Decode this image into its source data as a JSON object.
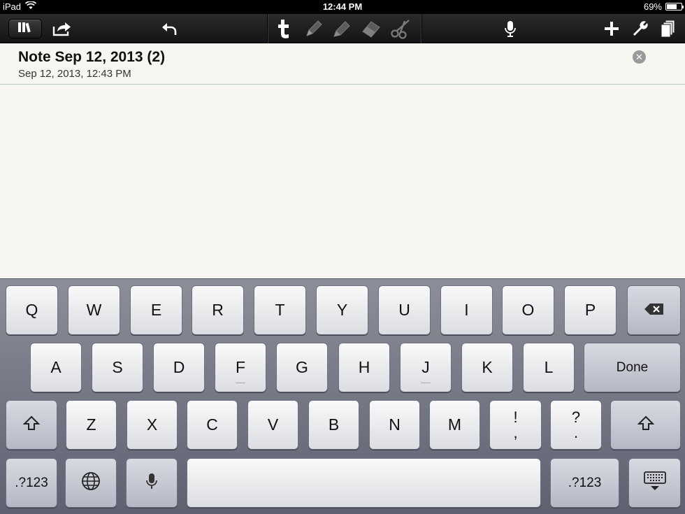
{
  "status_bar": {
    "device": "iPad",
    "time": "12:44 PM",
    "battery": "69%",
    "battery_level": 0.69
  },
  "toolbar": {
    "left_icons": [
      "library-icon",
      "share-icon",
      "undo-icon"
    ],
    "tool_icons": [
      "text-tool-icon",
      "pen-tool-icon",
      "highlighter-tool-icon",
      "eraser-tool-icon",
      "scissors-tool-icon"
    ],
    "right_icons": [
      "microphone-icon",
      "add-icon",
      "wrench-icon",
      "pages-icon"
    ]
  },
  "note": {
    "title": "Note Sep 12, 2013 (2)",
    "date": "Sep 12, 2013, 12:43 PM",
    "clear_glyph": "✕"
  },
  "keyboard": {
    "row1": [
      "Q",
      "W",
      "E",
      "R",
      "T",
      "Y",
      "U",
      "I",
      "O",
      "P"
    ],
    "row2": [
      "A",
      "S",
      "D",
      "F",
      "G",
      "H",
      "J",
      "K",
      "L"
    ],
    "row3": [
      "Z",
      "X",
      "C",
      "V",
      "B",
      "N",
      "M"
    ],
    "punct1": {
      "top": "!",
      "bottom": ","
    },
    "punct2": {
      "top": "?",
      "bottom": "."
    },
    "done_label": "Done",
    "numbers_label": ".?123",
    "numbers_label_right": ".?123"
  }
}
